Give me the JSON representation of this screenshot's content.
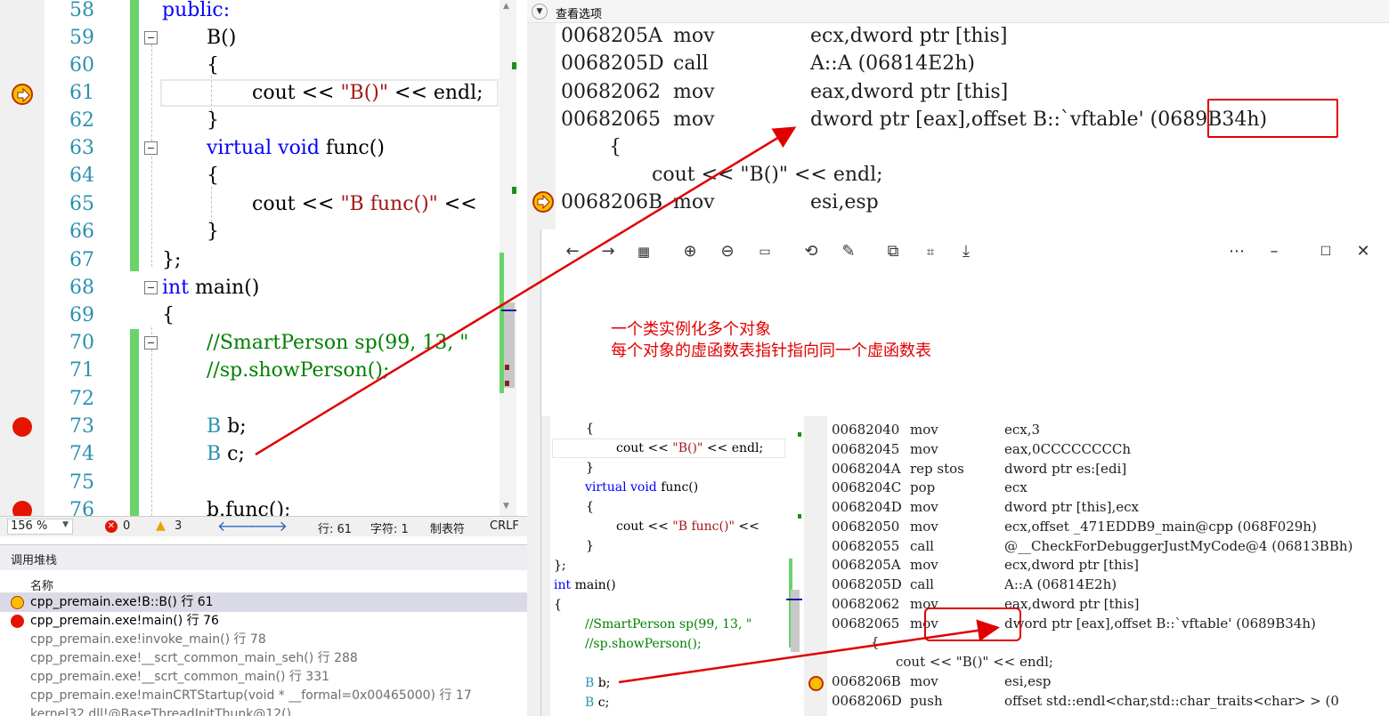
{
  "editor": {
    "lines": [
      {
        "no": "58",
        "text": "public:"
      },
      {
        "no": "59",
        "text": "B()"
      },
      {
        "no": "60",
        "text": "{"
      },
      {
        "no": "61",
        "text": "cout << \"B()\" << endl;"
      },
      {
        "no": "62",
        "text": "}"
      },
      {
        "no": "63",
        "text": "virtual void func()"
      },
      {
        "no": "64",
        "text": "{"
      },
      {
        "no": "65",
        "text": "cout << \"B func()\" <<"
      },
      {
        "no": "66",
        "text": "}"
      },
      {
        "no": "67",
        "text": "};"
      },
      {
        "no": "68",
        "text": "int main()"
      },
      {
        "no": "69",
        "text": "{"
      },
      {
        "no": "70",
        "text": "//SmartPerson sp(99, 13, \""
      },
      {
        "no": "71",
        "text": "//sp.showPerson();"
      },
      {
        "no": "72",
        "text": ""
      },
      {
        "no": "73",
        "text": "B b;"
      },
      {
        "no": "74",
        "text": "B c;"
      },
      {
        "no": "75",
        "text": ""
      },
      {
        "no": "76",
        "text": "b.func();"
      }
    ]
  },
  "status": {
    "zoom": "156 %",
    "errors": "0",
    "warnings": "3",
    "line": "行: 61",
    "char": "字符: 1",
    "tab": "制表符",
    "eol": "CRLF"
  },
  "callstack": {
    "title": "调用堆栈",
    "column_name": "名称",
    "rows": [
      "cpp_premain.exe!B::B() 行 61",
      "cpp_premain.exe!main() 行 76",
      "cpp_premain.exe!invoke_main() 行 78",
      "cpp_premain.exe!__scrt_common_main_seh() 行 288",
      "cpp_premain.exe!__scrt_common_main() 行 331",
      "cpp_premain.exe!mainCRTStartup(void * __formal=0x00465000) 行 17",
      "kernel32.dll!@BaseThreadInitThunk@12()"
    ]
  },
  "disasm": {
    "view_options": "查看选项",
    "rows": [
      {
        "addr": "0068205A",
        "op": "mov",
        "args": "ecx,dword ptr [this]"
      },
      {
        "addr": "0068205D",
        "op": "call",
        "args": "A::A (06814E2h)"
      },
      {
        "addr": "00682062",
        "op": "mov",
        "args": "eax,dword ptr [this]"
      },
      {
        "addr": "00682065",
        "op": "mov",
        "args": "dword ptr [eax],offset B::`vftable'"
      },
      {
        "addr": "",
        "op": "",
        "args": "{"
      },
      {
        "addr": "",
        "op": "",
        "args": "cout << \"B()\" << endl;"
      },
      {
        "addr": "0068206B",
        "op": "mov",
        "args": "esi,esp"
      }
    ],
    "vftable_addr": "(0689B34h)"
  },
  "viewer": {
    "note_line1": "一个类实例化多个对象",
    "note_line2": "每个对象的虚函数表指针指向同一个虚函数表",
    "inner_code": [
      "{",
      "cout << \"B()\" << endl;",
      "}",
      "virtual void func()",
      "{",
      "cout << \"B func()\" <<",
      "}",
      "};",
      "int main()",
      "{",
      "//SmartPerson sp(99, 13, \"",
      "//sp.showPerson();",
      "",
      "B b;",
      "B c;"
    ],
    "inner_dis": [
      {
        "addr": "00682040",
        "op": "mov",
        "args": "ecx,3"
      },
      {
        "addr": "00682045",
        "op": "mov",
        "args": "eax,0CCCCCCCCh"
      },
      {
        "addr": "0068204A",
        "op": "rep stos",
        "args": "dword ptr es:[edi]"
      },
      {
        "addr": "0068204C",
        "op": "pop",
        "args": "ecx"
      },
      {
        "addr": "0068204D",
        "op": "mov",
        "args": "dword ptr [this],ecx"
      },
      {
        "addr": "00682050",
        "op": "mov",
        "args": "ecx,offset _471EDDB9_main@cpp (068F029h)"
      },
      {
        "addr": "00682055",
        "op": "call",
        "args": "@__CheckForDebuggerJustMyCode@4 (06813BBh)"
      },
      {
        "addr": "0068205A",
        "op": "mov",
        "args": "ecx,dword ptr [this]"
      },
      {
        "addr": "0068205D",
        "op": "call",
        "args": "A::A (06814E2h)"
      },
      {
        "addr": "00682062",
        "op": "mov",
        "args": "eax,dword ptr [this]"
      },
      {
        "addr": "00682065",
        "op": "mov",
        "args": "dword ptr [eax],offset B::`vftable'"
      },
      {
        "addr": "",
        "op": "",
        "args": "{"
      },
      {
        "addr": "",
        "op": "",
        "args": "cout << \"B()\" << endl;"
      },
      {
        "addr": "0068206B",
        "op": "mov",
        "args": "esi,esp"
      },
      {
        "addr": "0068206D",
        "op": "push",
        "args": "offset std::endl<char,std::char_traits<char> > (0"
      }
    ],
    "vftable_addr": "(0689B34h)"
  },
  "colors": {
    "annotation_red": "#e00000",
    "breakpoint_red": "#e51400",
    "change_bar_green": "#6ad36a",
    "keyword_blue": "#0000ff",
    "string_red": "#a31515",
    "comment_green": "#008000",
    "type_teal": "#2b91af"
  }
}
